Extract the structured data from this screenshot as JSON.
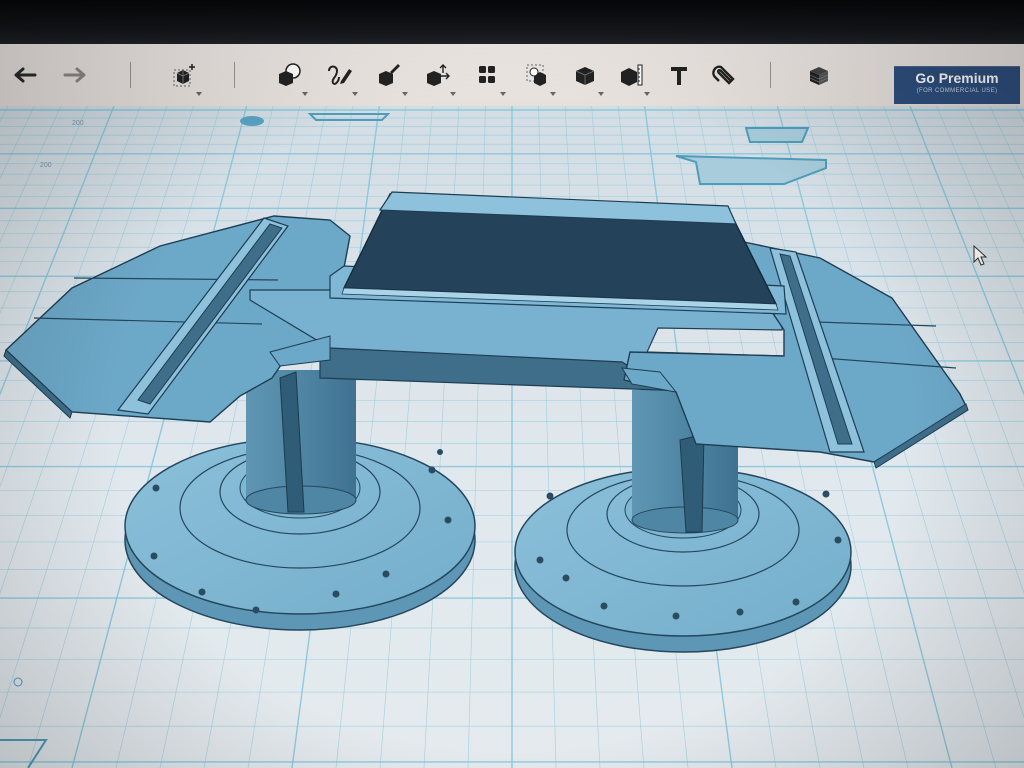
{
  "toolbar": {
    "undo_icon": "undo-arrow-icon",
    "redo_icon": "redo-arrow-icon",
    "tools": [
      {
        "name": "move-tool",
        "icon": "cube-move-icon"
      },
      {
        "name": "shape-generator-tool",
        "icon": "cube-sphere-icon"
      },
      {
        "name": "sketch-tool",
        "icon": "pen-scribble-icon"
      },
      {
        "name": "modify-tool",
        "icon": "cube-brush-icon"
      },
      {
        "name": "adjust-tool",
        "icon": "cube-arrows-icon"
      },
      {
        "name": "pattern-tool",
        "icon": "grid-cubes-icon"
      },
      {
        "name": "group-tool",
        "icon": "cube-cube-icon"
      },
      {
        "name": "boolean-tool",
        "icon": "cube-solid-icon"
      },
      {
        "name": "measure-tool",
        "icon": "cube-ruler-icon"
      },
      {
        "name": "text-tool",
        "icon": "text-T-icon"
      },
      {
        "name": "snap-tool",
        "icon": "magnet-icon"
      },
      {
        "name": "material-tool",
        "icon": "stack-cube-icon"
      }
    ],
    "premium": {
      "title": "Go Premium",
      "subtitle": "(FOR COMMERCIAL USE)"
    }
  },
  "workplane": {
    "grid_labels": [
      "200",
      "200"
    ]
  },
  "colors": {
    "toolbar_bg": "#ebe6e2",
    "premium_bg": "#2e4f7e",
    "grid_line": "#86c6dc",
    "model_blue": "#6aa9c9",
    "model_dark": "#3d6a83",
    "deck_dark": "#24435a"
  }
}
